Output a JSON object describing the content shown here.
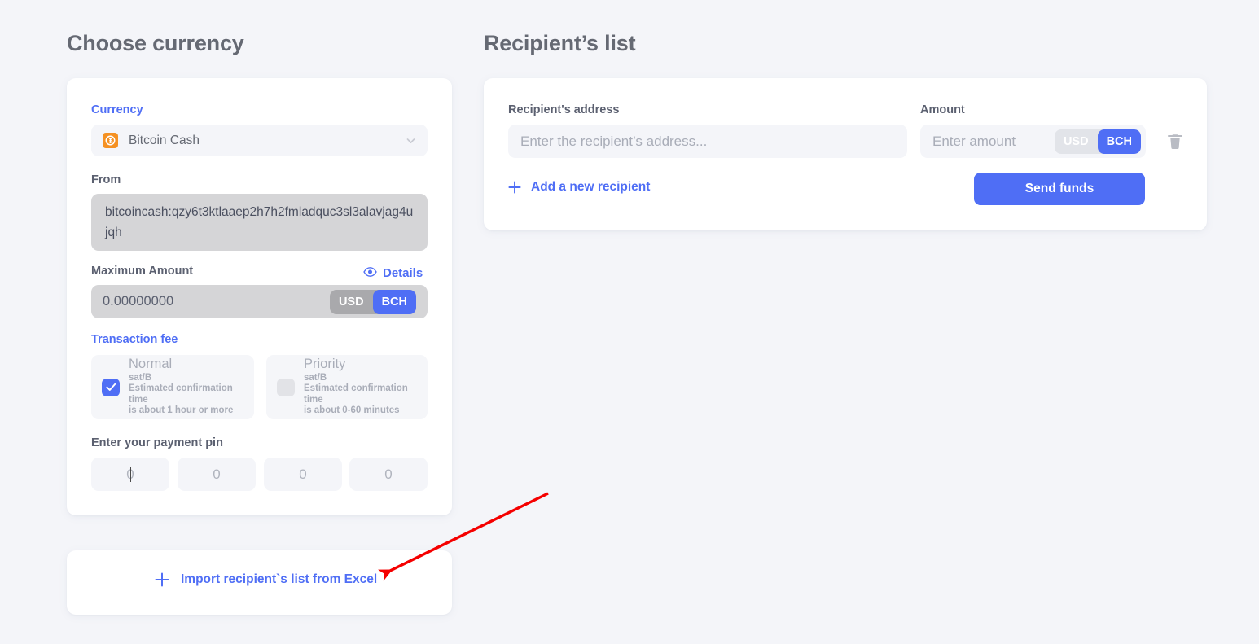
{
  "colors": {
    "background": "#f4f5f9",
    "card": "#ffffff",
    "accent_blue": "#4f6ef5",
    "text_grey": "#656973",
    "placeholder": "#a9adb8",
    "toggle_dark": "#a9a9ac",
    "toggle_light": "#e2e4e9",
    "coin_orange": "#f59123",
    "annotation_red": "#f50000",
    "address_box": "#d5d5d7"
  },
  "left_column": {
    "title": "Choose currency",
    "currency": {
      "label": "Currency",
      "icon": "bitcoin-cash-coin-icon",
      "selected": "Bitcoin Cash",
      "chevron": "chevron-down-icon"
    },
    "from": {
      "label": "From",
      "address": "bitcoincash:qzy6t3ktlaaep2h7h2fmladquc3sl3alavjag4ujqh"
    },
    "maximum_amount": {
      "label": "Maximum Amount",
      "value": "0.00000000",
      "details_link": "Details",
      "details_icon": "eye-icon",
      "units": [
        "USD",
        "BCH"
      ],
      "selected_unit": "BCH"
    },
    "transaction_fee": {
      "label": "Transaction fee",
      "options": [
        {
          "name": "Normal",
          "unit": "sat/B",
          "eta_line1": "Estimated confirmation time",
          "eta_line2": "is about 1 hour or more",
          "selected": true
        },
        {
          "name": "Priority",
          "unit": "sat/B",
          "eta_line1": "Estimated confirmation time",
          "eta_line2": "is about 0-60 minutes",
          "selected": false
        }
      ]
    },
    "payment_pin": {
      "label": "Enter your payment pin",
      "digits": [
        "0",
        "0",
        "0",
        "0"
      ],
      "focused_index": 0
    },
    "import": {
      "icon": "plus-icon",
      "label": "Import recipient`s list from Excel"
    }
  },
  "right_column": {
    "title": "Recipient’s list",
    "address_field": {
      "label": "Recipient's address",
      "value": "",
      "placeholder": "Enter the recipient’s address..."
    },
    "amount_field": {
      "label": "Amount",
      "value": "",
      "placeholder": "Enter amount",
      "units": [
        "USD",
        "BCH"
      ],
      "selected_unit": "BCH"
    },
    "delete_icon": "trash-icon",
    "add_recipient": {
      "icon": "plus-icon",
      "label": "Add a new recipient"
    },
    "send_button": "Send funds"
  },
  "annotation": {
    "type": "arrow",
    "color": "#f50000",
    "from": [
      673,
      606
    ],
    "to": [
      467,
      707
    ],
    "points_to": "import-recipients-list-from-excel-link"
  }
}
